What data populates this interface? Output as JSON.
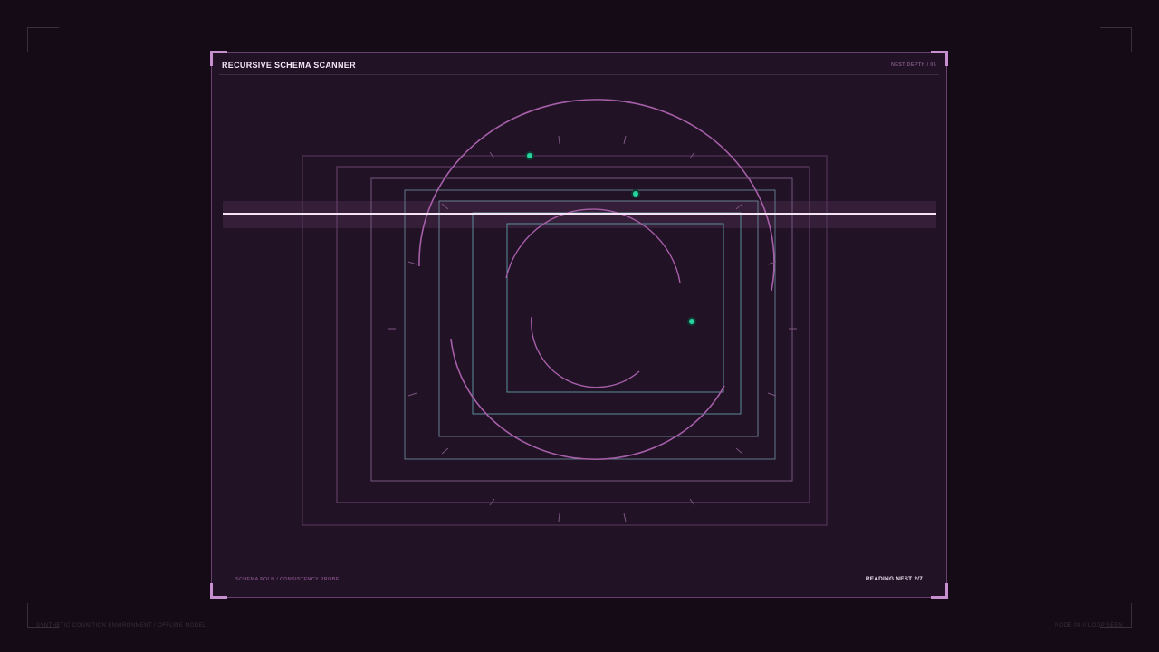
{
  "panel": {
    "title": "RECURSIVE SCHEMA SCANNER",
    "meta": "NEST DEPTH / 06",
    "footer_left": "SCHEMA FOLD / CONSISTENCY PROBE",
    "footer_right": "READING NEST 2/7"
  },
  "footer": {
    "left": "SYNTHETIC COGNITION ENVIRONMENT / OFFLINE MODEL",
    "right": "NODE 04 // LOOP SEEN"
  },
  "colors": {
    "background": "#150b17",
    "panel": "#211226",
    "accent_pink": "#b26ab4",
    "accent_teal": "#5c8f9a",
    "node_green": "#29d3a0",
    "scan_line": "#f3e3f3"
  },
  "viz": {
    "nest_count": 7,
    "active_nest": 2
  }
}
